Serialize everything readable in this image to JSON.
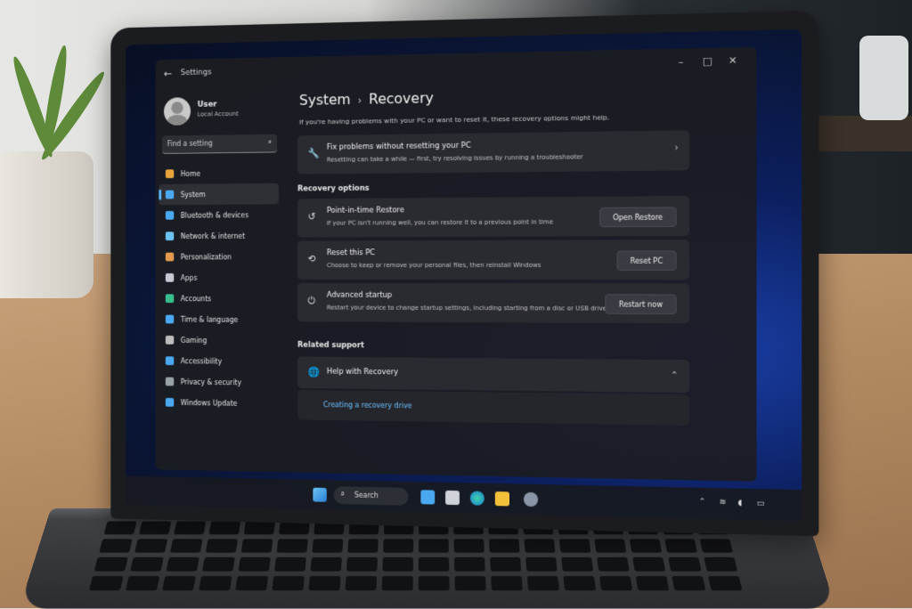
{
  "window": {
    "app_title": "Settings",
    "back_icon": "back-arrow-icon",
    "minimize": "–",
    "maximize": "□",
    "close": "✕"
  },
  "user": {
    "name": "User",
    "account_type": "Local Account"
  },
  "search": {
    "placeholder": "Find a setting"
  },
  "sidebar": {
    "items": [
      {
        "label": "Home",
        "icon": "home-icon",
        "color": "#e8a43a"
      },
      {
        "label": "System",
        "icon": "system-icon",
        "color": "#4aa8f0",
        "active": true
      },
      {
        "label": "Bluetooth & devices",
        "icon": "bluetooth-icon",
        "color": "#4aa8f0"
      },
      {
        "label": "Network & internet",
        "icon": "network-icon",
        "color": "#6cc4f5"
      },
      {
        "label": "Personalization",
        "icon": "brush-icon",
        "color": "#e39a4f"
      },
      {
        "label": "Apps",
        "icon": "apps-icon",
        "color": "#c9c9d6"
      },
      {
        "label": "Accounts",
        "icon": "accounts-icon",
        "color": "#37c08d"
      },
      {
        "label": "Time & language",
        "icon": "globe-clock-icon",
        "color": "#4aa8f0"
      },
      {
        "label": "Gaming",
        "icon": "gamepad-icon",
        "color": "#bdbdbd"
      },
      {
        "label": "Accessibility",
        "icon": "accessibility-icon",
        "color": "#4aa8f0"
      },
      {
        "label": "Privacy & security",
        "icon": "shield-icon",
        "color": "#9aa0a8"
      },
      {
        "label": "Windows Update",
        "icon": "update-icon",
        "color": "#4aa8f0"
      }
    ]
  },
  "page": {
    "breadcrumb_parent": "System",
    "breadcrumb_sep": "›",
    "title": "Recovery",
    "intro": "If you're having problems with your PC or want to reset it, these recovery options might help."
  },
  "fix_card": {
    "title": "Fix problems without resetting your PC",
    "subtitle": "Resetting can take a while — first, try resolving issues by running a troubleshooter",
    "chevron": "›"
  },
  "recovery_options": {
    "heading": "Recovery options",
    "items": [
      {
        "title": "Point-in-time Restore",
        "subtitle": "If your PC isn't running well, you can restore it to a previous point in time",
        "button": "Open Restore"
      },
      {
        "title": "Reset this PC",
        "subtitle": "Choose to keep or remove your personal files, then reinstall Windows",
        "button": "Reset PC"
      },
      {
        "title": "Advanced startup",
        "subtitle": "Restart your device to change startup settings, including starting from a disc or USB drive",
        "button": "Restart now"
      }
    ]
  },
  "related_support": {
    "heading": "Related support",
    "help_title": "Help with Recovery",
    "collapse_chevron": "⌃",
    "link": "Creating a recovery drive"
  },
  "taskbar": {
    "search_label": "Search",
    "apps": [
      "start-icon",
      "widgets-icon",
      "files-icon",
      "edge-icon",
      "explorer-icon",
      "settings-icon"
    ]
  }
}
